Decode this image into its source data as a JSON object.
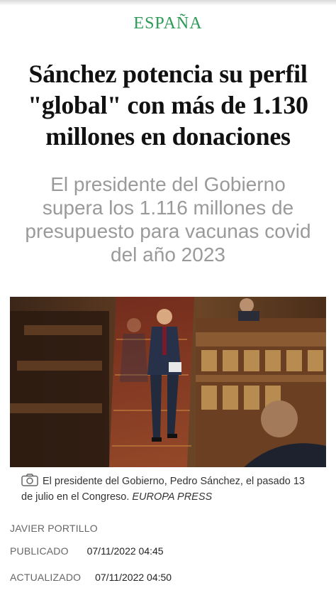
{
  "section": "ESPAÑA",
  "headline": [
    "Sánchez potencia su perfil",
    "\"global\" con más de 1.130",
    "millones en donaciones"
  ],
  "subheadline": [
    "El presidente del Gobierno",
    "supera los 1.116 millones de",
    "presupuesto para vacunas covid",
    "del año 2023"
  ],
  "photo": {
    "caption": "El presidente del Gobierno, Pedro Sánchez, el pasado 13 de julio en el Congreso.",
    "agency": "EUROPA PRESS",
    "icon": "camera-icon"
  },
  "byline": {
    "author": "JAVIER PORTILLO"
  },
  "published": {
    "label": "PUBLICADO",
    "value": "07/11/2022 04:45"
  },
  "updated": {
    "label": "ACTUALIZADO",
    "value": "07/11/2022 04:50"
  },
  "colors": {
    "section": "#2e9a58",
    "subheadline": "#9a9a9a"
  }
}
